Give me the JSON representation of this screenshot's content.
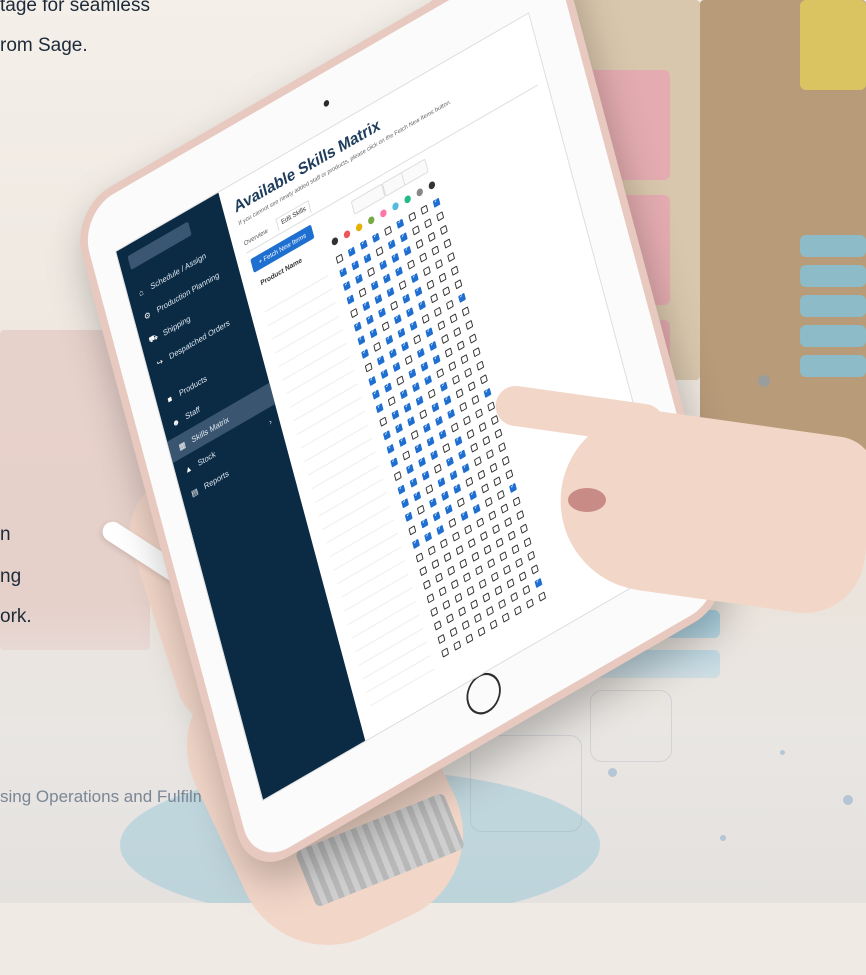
{
  "overlay": {
    "line1": "tage for seamless",
    "line2": "rom Sage.",
    "line3": "n",
    "line4": "ng",
    "line5": "ork.",
    "caption": "sing Operations and Fulfilment"
  },
  "app": {
    "page_title": "Available Skills Matrix",
    "page_subtitle": "If you cannot see newly added staff or products, please click on the Fetch New Items button.",
    "tabs": [
      "Overview",
      "Edit Skills"
    ],
    "fetch_button": "+ Fetch New Items",
    "product_column": "Product Name",
    "nav": [
      {
        "label": "Schedule / Assign",
        "icon": "home-icon",
        "glyph": "⌂"
      },
      {
        "label": "Production Planning",
        "icon": "production-icon",
        "glyph": "⚙"
      },
      {
        "label": "Shipping",
        "icon": "truck-icon",
        "glyph": "⛟"
      },
      {
        "label": "Despatched Orders",
        "icon": "despatch-icon",
        "glyph": "↪"
      },
      {
        "label": "Products",
        "icon": "box-icon",
        "glyph": "■"
      },
      {
        "label": "Staff",
        "icon": "staff-icon",
        "glyph": "☻"
      },
      {
        "label": "Skills Matrix",
        "icon": "matrix-icon",
        "glyph": "▦"
      },
      {
        "label": "Stock",
        "icon": "stock-icon",
        "glyph": "▲"
      },
      {
        "label": "Reports",
        "icon": "reports-icon",
        "glyph": "▤"
      }
    ],
    "active_nav": "Skills Matrix",
    "accent_color": "#1f6fd1",
    "sidebar_color": "#0b2a44"
  }
}
